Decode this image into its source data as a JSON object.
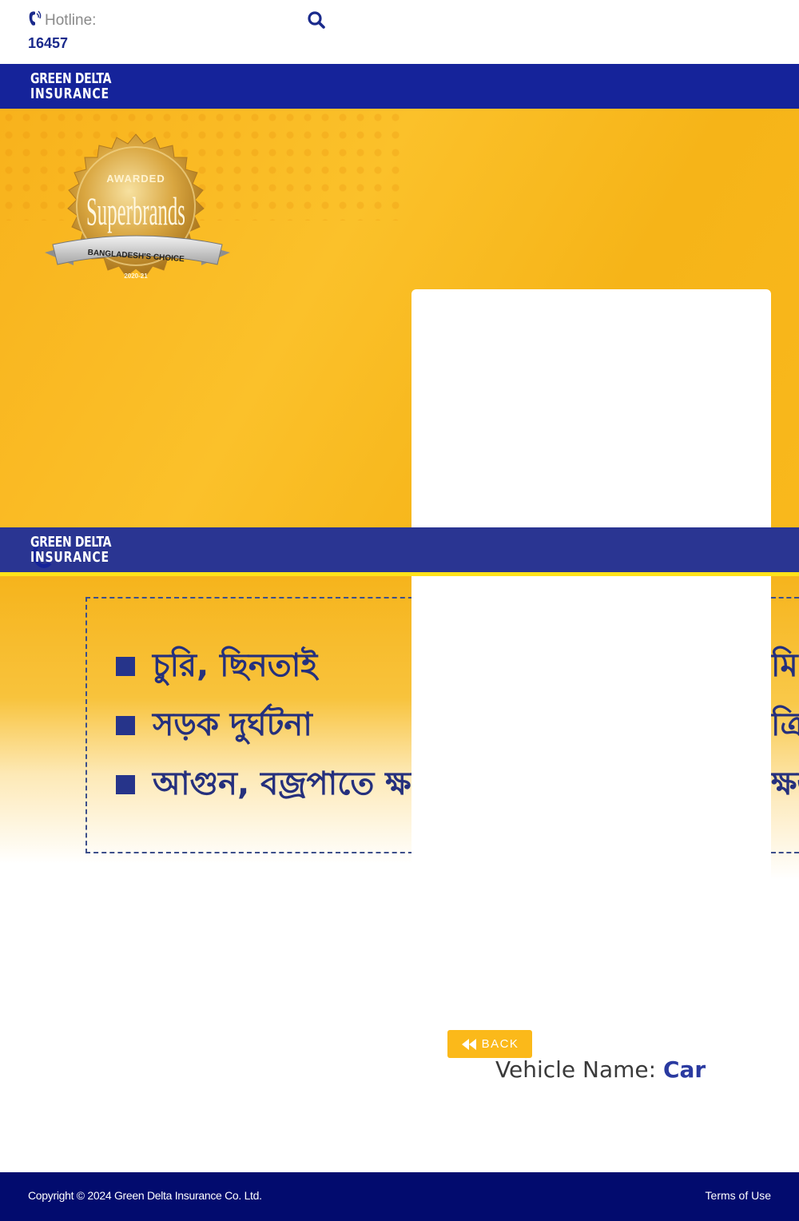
{
  "header": {
    "hotline_label": "Hotline:",
    "hotline_number": "16457",
    "search_icon": "search-icon",
    "phone_icon": "phone-icon"
  },
  "brand": {
    "name_line1": "GREEN DELTA",
    "name_line2": "INSURANCE",
    "primary_color": "#15239a",
    "accent_color": "#fbb91a"
  },
  "hero": {
    "badge_top": "AWARDED",
    "badge_title": "Superbrands",
    "badge_ribbon": "BANGLADESH'S CHOICE",
    "badge_year": "2020-21"
  },
  "banner": {
    "bullets": [
      "চুরি, ছিনতাই",
      "সড়ক দুর্ঘটনা",
      "আগুন, বজ্রপাতে ক্ষতি"
    ],
    "bullets_right": [
      "মি",
      "ত্রি",
      "ক্ষত"
    ]
  },
  "content": {
    "back_label": "BACK",
    "vehicle_label": "Vehicle Name:",
    "vehicle_value": "Car"
  },
  "footer": {
    "copyright": "Copyright © 2024 Green Delta Insurance Co. Ltd.",
    "terms": "Terms of Use"
  }
}
